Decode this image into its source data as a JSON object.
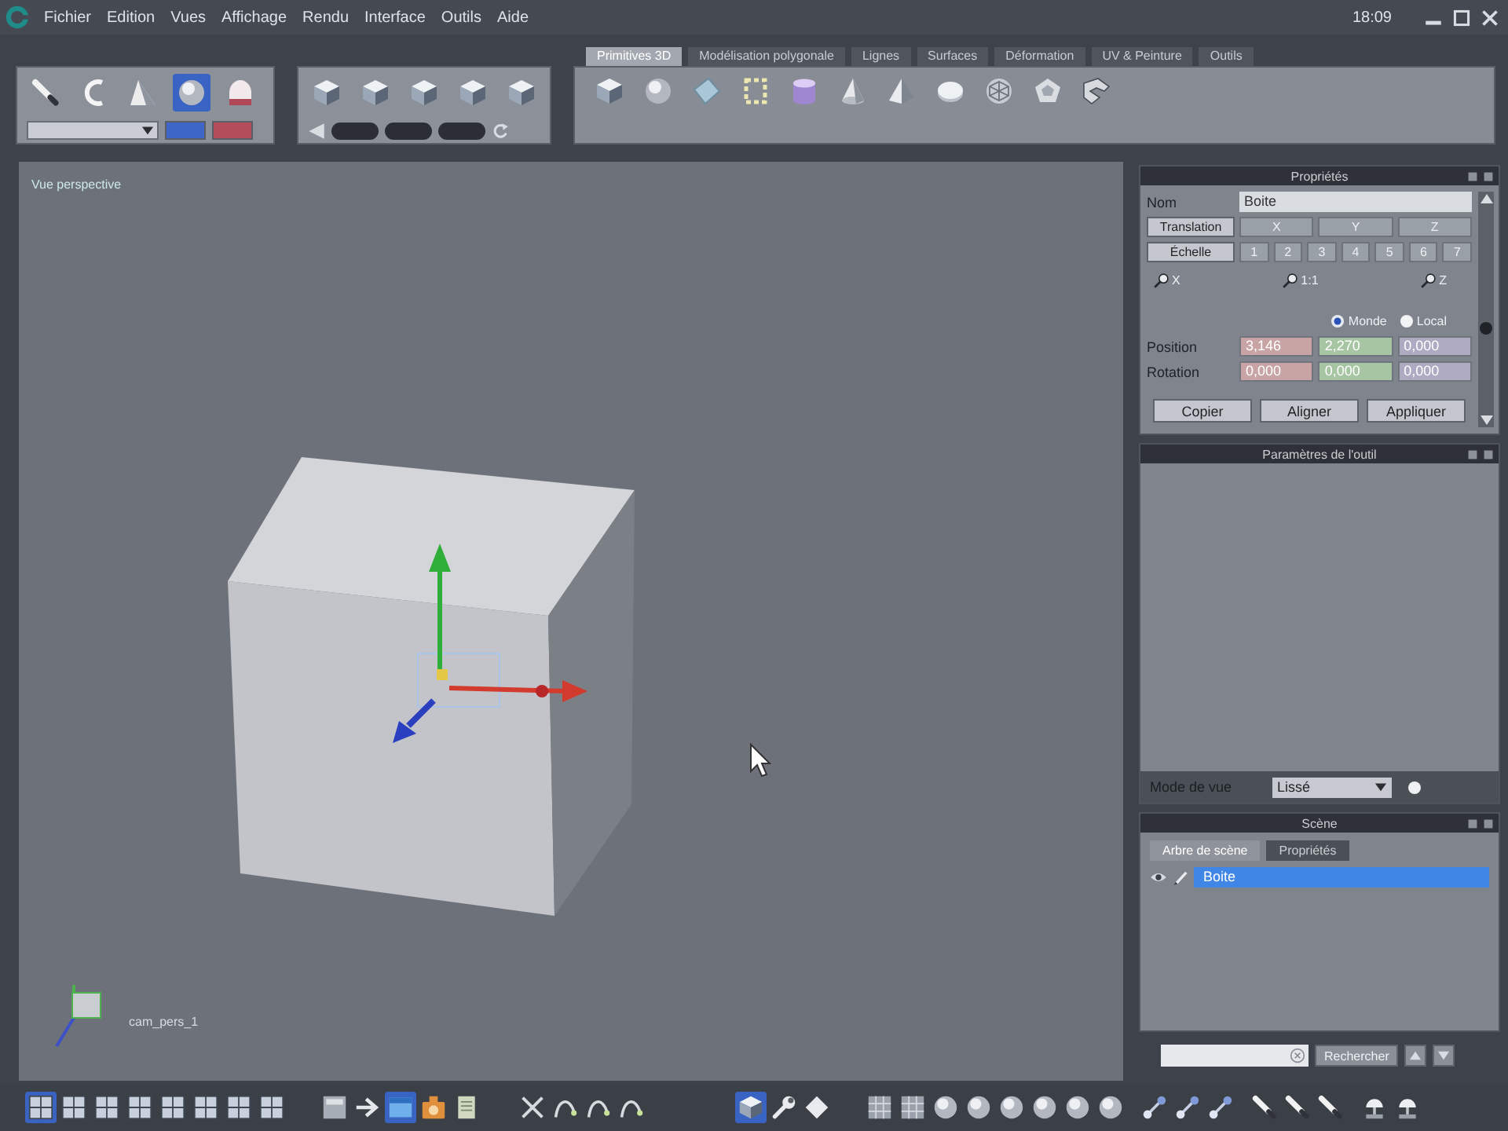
{
  "menu_bar": {
    "items": [
      "Fichier",
      "Edition",
      "Vues",
      "Affichage",
      "Rendu",
      "Interface",
      "Outils",
      "Aide"
    ],
    "clock": "18:09"
  },
  "tool_groups": [
    {
      "tools": [
        {
          "kind": "brush",
          "selected": false
        },
        {
          "kind": "lasso",
          "selected": false
        },
        {
          "kind": "wedge",
          "selected": false
        },
        {
          "kind": "sphere",
          "selected": true
        },
        {
          "kind": "dome",
          "selected": false
        }
      ]
    },
    {
      "tools": [
        {
          "kind": "cube",
          "selected": false
        },
        {
          "kind": "cube",
          "selected": false
        },
        {
          "kind": "cube",
          "selected": false
        },
        {
          "kind": "cube",
          "selected": false
        },
        {
          "kind": "cube",
          "selected": false
        }
      ]
    }
  ],
  "tabs": [
    {
      "label": "Primitives 3D",
      "selected": true
    },
    {
      "label": "Modélisation polygonale",
      "selected": false
    },
    {
      "label": "Lignes",
      "selected": false
    },
    {
      "label": "Surfaces",
      "selected": false
    },
    {
      "label": "Déformation",
      "selected": false
    },
    {
      "label": "UV & Peinture",
      "selected": false
    },
    {
      "label": "Outils",
      "selected": false
    }
  ],
  "primitives": [
    {
      "kind": "cube"
    },
    {
      "kind": "sphere"
    },
    {
      "kind": "plane"
    },
    {
      "kind": "frame"
    },
    {
      "kind": "cylinder"
    },
    {
      "kind": "cone"
    },
    {
      "kind": "pyramid"
    },
    {
      "kind": "disc"
    },
    {
      "kind": "geosphere"
    },
    {
      "kind": "polyhedron"
    },
    {
      "kind": "twist"
    }
  ],
  "viewport": {
    "label": "Vue perspective",
    "camera_label": "cam_pers_1"
  },
  "properties": {
    "title": "Propriétés",
    "name_label": "Nom",
    "name_value": "Boite",
    "translation": {
      "label": "Translation",
      "cells": [
        "X",
        "Y",
        "Z"
      ]
    },
    "scale": {
      "label": "Échelle",
      "cells": [
        "1",
        "2",
        "3",
        "4",
        "5",
        "6",
        "7"
      ]
    },
    "axes": [
      "X",
      "1:1",
      "Z"
    ],
    "space": [
      {
        "label": "Monde",
        "selected": true
      },
      {
        "label": "Local",
        "selected": false
      }
    ],
    "rows": [
      {
        "label": "Position",
        "values": [
          "3,146",
          "2,270",
          "0,000"
        ]
      },
      {
        "label": "Rotation",
        "values": [
          "0,000",
          "0,000",
          "0,000"
        ]
      }
    ],
    "buttons": [
      "Copier",
      "Aligner",
      "Appliquer"
    ]
  },
  "tool_options": {
    "title": "Paramètres de l'outil",
    "mode_label": "Mode de vue",
    "mode_value": "Lissé"
  },
  "scene": {
    "title": "Scène",
    "tabs": [
      {
        "label": "Arbre de scène",
        "selected": true
      },
      {
        "label": "Propriétés",
        "selected": false
      }
    ],
    "items": [
      {
        "label": "Boite",
        "selected": true
      }
    ],
    "search_button": "Rechercher"
  },
  "bottom_toolbar": [
    {
      "tools": [
        {
          "kind": "layout",
          "selected": true
        },
        {
          "kind": "layout",
          "selected": false
        },
        {
          "kind": "layout",
          "selected": false
        },
        {
          "kind": "layout",
          "selected": false
        },
        {
          "kind": "layout",
          "selected": false
        },
        {
          "kind": "layout",
          "selected": false
        },
        {
          "kind": "layout",
          "selected": false
        },
        {
          "kind": "layout",
          "selected": false
        }
      ]
    },
    {
      "tools": [
        {
          "kind": "panel",
          "selected": false
        },
        {
          "kind": "arrow",
          "selected": false
        },
        {
          "kind": "window",
          "selected": true
        },
        {
          "kind": "camera",
          "selected": false
        },
        {
          "kind": "document",
          "selected": false
        }
      ]
    },
    {
      "tools": [
        {
          "kind": "cross",
          "selected": false
        },
        {
          "kind": "curve",
          "selected": false
        },
        {
          "kind": "curve",
          "selected": false
        },
        {
          "kind": "curve",
          "selected": false
        }
      ]
    },
    {
      "tools": [
        {
          "kind": "cube",
          "selected": true
        },
        {
          "kind": "wrench",
          "selected": false
        },
        {
          "kind": "diamond",
          "selected": false
        }
      ]
    },
    {
      "tools": [
        {
          "kind": "grid",
          "selected": false
        },
        {
          "kind": "grid",
          "selected": false
        },
        {
          "kind": "sphere",
          "selected": false
        },
        {
          "kind": "sphere",
          "selected": false
        },
        {
          "kind": "sphere",
          "selected": false
        },
        {
          "kind": "sphere",
          "selected": false
        },
        {
          "kind": "sphere",
          "selected": false
        },
        {
          "kind": "sphere",
          "selected": false
        }
      ]
    },
    {
      "tools": [
        {
          "kind": "connector",
          "selected": false
        },
        {
          "kind": "connector",
          "selected": false
        },
        {
          "kind": "connector",
          "selected": false
        }
      ]
    },
    {
      "tools": [
        {
          "kind": "brush",
          "selected": false
        },
        {
          "kind": "brush",
          "selected": false
        },
        {
          "kind": "brush",
          "selected": false
        }
      ]
    },
    {
      "tools": [
        {
          "kind": "lamp",
          "selected": false
        },
        {
          "kind": "lamp",
          "selected": false
        }
      ]
    }
  ]
}
